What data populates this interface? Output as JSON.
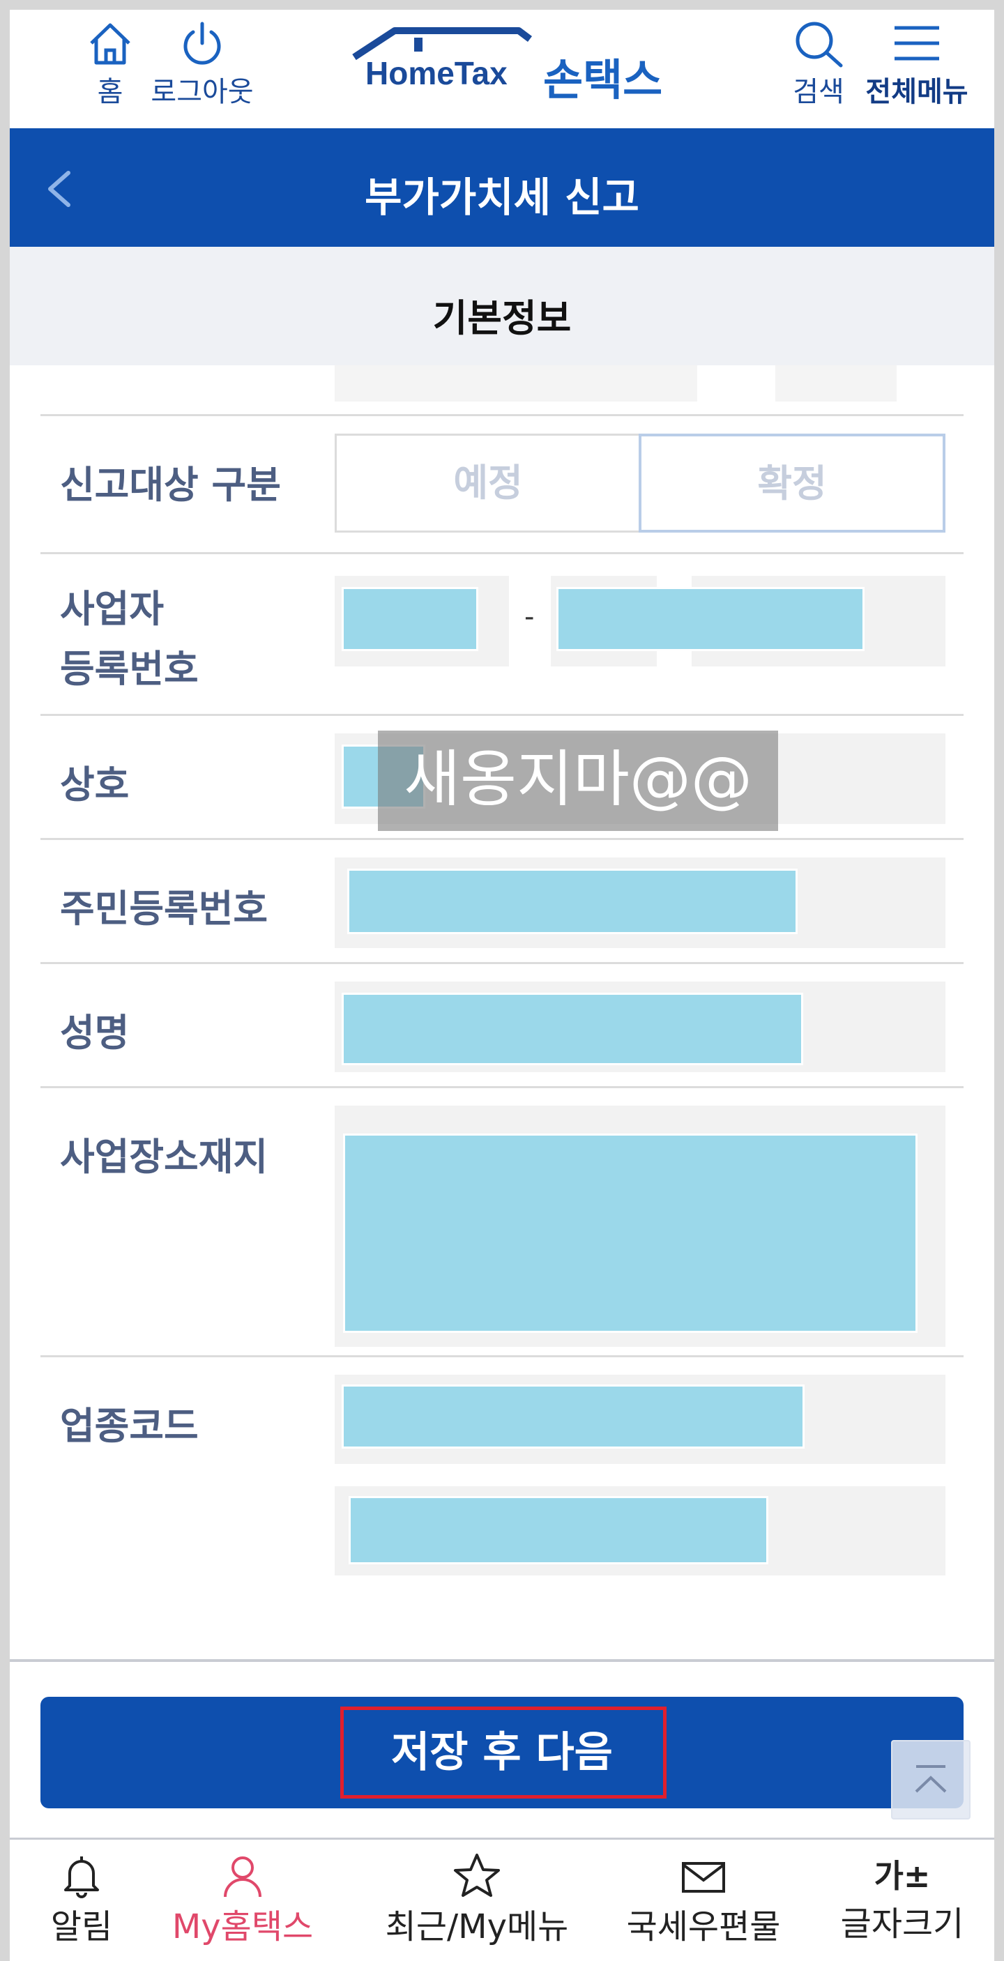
{
  "header": {
    "home_label": "홈",
    "logout_label": "로그아웃",
    "logo_text": "HomeTax",
    "logo_korean": "손택스",
    "search_label": "검색",
    "menu_label": "전체메뉴"
  },
  "page": {
    "title": "부가가치세 신고",
    "section_title": "기본정보"
  },
  "form": {
    "report_type_label": "신고대상 구분",
    "report_type_options": [
      "예정",
      "확정"
    ],
    "report_type_selected": "확정",
    "business_number_label_line1": "사업자",
    "business_number_label_line2": "등록번호",
    "business_number_separator": "-",
    "company_name_label": "상호",
    "resident_number_label": "주민등록번호",
    "name_label": "성명",
    "address_label": "사업장소재지",
    "industry_code_label": "업종코드"
  },
  "watermark": "새옹지마@@",
  "actions": {
    "save_next_label": "저장 후 다음"
  },
  "tabbar": {
    "items": [
      {
        "label": "알림",
        "icon": "bell-icon"
      },
      {
        "label": "My홈택스",
        "icon": "person-icon",
        "active": true
      },
      {
        "label": "최근/My메뉴",
        "icon": "star-icon"
      },
      {
        "label": "국세우편물",
        "icon": "mail-icon"
      },
      {
        "label": "글자크기",
        "icon": "font-size-icon"
      }
    ]
  },
  "colors": {
    "primary_blue": "#0e4fae",
    "label_color": "#4d5e82",
    "mask_color": "#9bd8ea",
    "active_tab": "#e0486a",
    "highlight_red": "#e01f2d"
  }
}
